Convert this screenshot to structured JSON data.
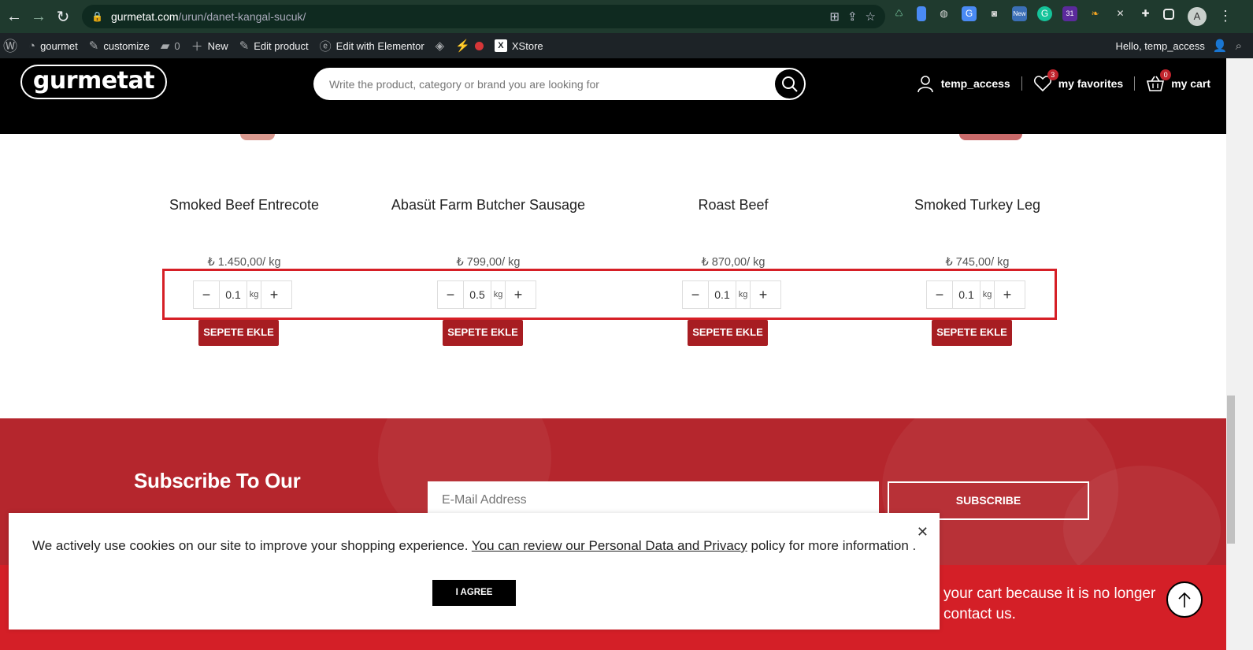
{
  "browser": {
    "url_host": "gurmetat.com",
    "url_path": "/urun/danet-kangal-sucuk/",
    "profile_initial": "A"
  },
  "wp_admin_bar": {
    "site": "gourmet",
    "customize": "customize",
    "comments": "0",
    "new": "New",
    "edit_product": "Edit product",
    "edit_elementor": "Edit with Elementor",
    "xstore": "XStore",
    "greeting": "Hello, temp_access"
  },
  "header": {
    "logo": "gurmetat",
    "search_placeholder": "Write the product, category or brand you are looking for",
    "account": "temp_access",
    "favorites": "my favorites",
    "favorites_count": "3",
    "cart": "my cart",
    "cart_count": "0"
  },
  "products": [
    {
      "name": "Smoked Beef Entrecote",
      "price": "₺ 1.450,00/ kg",
      "qty": "0.1",
      "unit": "kg",
      "button": "SEPETE EKLE"
    },
    {
      "name": "Abasüt Farm Butcher Sausage",
      "price": "₺ 799,00/ kg",
      "qty": "0.5",
      "unit": "kg",
      "button": "SEPETE EKLE"
    },
    {
      "name": "Roast Beef",
      "price": "₺ 870,00/ kg",
      "qty": "0.1",
      "unit": "kg",
      "button": "SEPETE EKLE"
    },
    {
      "name": "Smoked Turkey Leg",
      "price": "₺ 745,00/ kg",
      "qty": "0.1",
      "unit": "kg",
      "button": "SEPETE EKLE"
    }
  ],
  "newsletter": {
    "title": "Subscribe To Our",
    "email_placeholder": "E-Mail Address",
    "button": "SUBSCRIBE"
  },
  "notice": {
    "line1": "your cart because it is no longer",
    "line2": "contact us."
  },
  "cookie": {
    "text_before": "We actively use cookies on our site to improve your shopping experience. ",
    "link": "You can review our Personal Data and Privacy",
    "text_after": " policy for more information .",
    "button": "I AGREE"
  },
  "colors": {
    "brand_red": "#a71d22",
    "highlight_red": "#d61f26",
    "footer_red": "#b5262d",
    "header_black": "#000000"
  }
}
